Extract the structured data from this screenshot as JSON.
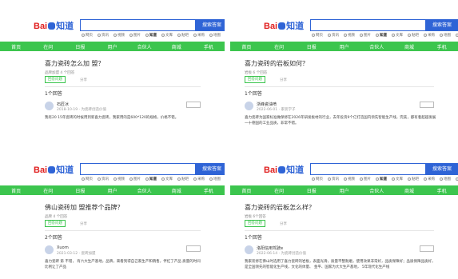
{
  "common": {
    "logo_text": "Bai",
    "logo_suffix": "知道",
    "search_btn": "搜索答案",
    "ask_btn": "我要提问",
    "tabs": [
      "网页",
      "资讯",
      "视频",
      "图片",
      "知道",
      "文库",
      "贴吧",
      "采购",
      "地图",
      "更多"
    ],
    "nav": [
      "首页",
      "在问",
      "日报",
      "用户",
      "合伙人",
      "商城",
      "手机"
    ],
    "answer_btn": "回答问题",
    "share": "分享"
  },
  "panels": [
    {
      "question": "喜力瓷砖怎么加 盟？",
      "meta": "品牌加盟 4 个回答",
      "answers_count": "1个回答",
      "user": "石匠冰",
      "time": "2018-10-19 · 为瓷砖创造价值",
      "answer": "我有20 15年瓷砖的时候用到新喜力瓷砖，我家用的是600*120的规格，价格不错。"
    },
    {
      "question": "喜力瓷砖的岩板如何？",
      "meta": "岩板 6 个回答",
      "answers_count": "1个回答",
      "user": "浙峰瓷油喷",
      "time": "2022-06-01 · 家装学子",
      "answer": "喜力瓷砖为国家标准做保修在2026年研发板材的行业，去年投资9个亿打造国内领先智能生产线，完美，都有着超越发展一十德国的工业品质，非常不错。"
    },
    {
      "question": "佛山瓷砖加 盟推荐个品牌？",
      "meta": "品牌 4 个回答",
      "answers_count": "2个回答",
      "user": "Xuorn",
      "time": "2021-03-12 · 瓷砖加盟",
      "answer": "喜力瓷砖 第 不错， 有六大生产基地，品牌，来看到得自己家生产和销售，伴红了产品 质量的时间 比例让了产品"
    },
    {
      "question": "喜力瓷砖的岩板怎么样？",
      "meta": "岩板 6个回答",
      "answers_count": "1个回答",
      "user": "洛阳信用驾驶e",
      "time": "2022-06-14 · 为瓷砖创造价值",
      "answer": "我家装修在佛山时选用了喜力瓷砖的岩板，表面光滑，质量平整耐磨，使用效果非常好，品质保障好；品质保障品质好，是全国领先的智能化生产线，文化的体量、 金平、国家为大大生产基地， 5年现代化生产线"
    }
  ]
}
